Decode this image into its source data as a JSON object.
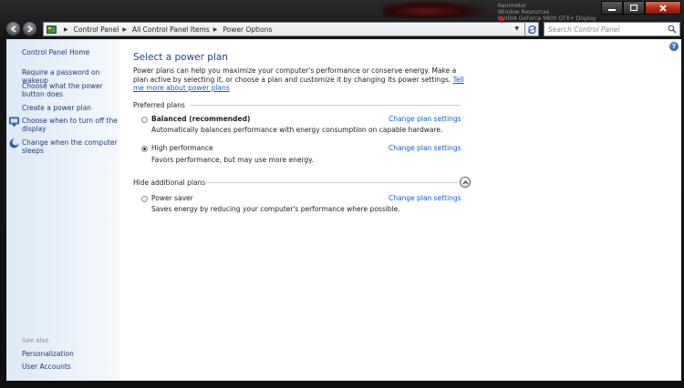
{
  "window": {
    "background_text": [
      "",
      "Rainmeter",
      "Window Resources",
      "",
      "NVIDIA GeForce 9800 GTX+ Display"
    ]
  },
  "address_bar": {
    "breadcrumbs": [
      "Control Panel",
      "All Control Panel Items",
      "Power Options"
    ],
    "search_placeholder": "Search Control Panel"
  },
  "sidebar": {
    "home_label": "Control Panel Home",
    "links": [
      {
        "label": "Require a password on wakeup"
      },
      {
        "label": "Choose what the power button does"
      },
      {
        "label": "Create a power plan"
      },
      {
        "label": "Choose when to turn off the display"
      },
      {
        "label": "Change when the computer sleeps"
      }
    ],
    "see_also_label": "See also",
    "see_also_links": [
      {
        "label": "Personalization"
      },
      {
        "label": "User Accounts"
      }
    ]
  },
  "main": {
    "title": "Select a power plan",
    "intro": "Power plans can help you maximize your computer's performance or conserve energy. Make a plan active by selecting it, or choose a plan and customize it by changing its power settings.",
    "intro_link": "Tell me more about power plans",
    "preferred_header": "Preferred plans",
    "hide_header": "Hide additional plans",
    "plans": [
      {
        "name": "Balanced (recommended)",
        "description": "Automatically balances performance with energy consumption on capable hardware.",
        "link": "Change plan settings",
        "selected": false
      },
      {
        "name": "High performance",
        "description": "Favors performance, but may use more energy.",
        "link": "Change plan settings",
        "selected": true
      },
      {
        "name": "Power saver",
        "description": "Saves energy by reducing your computer's performance where possible.",
        "link": "Change plan settings",
        "selected": false
      }
    ]
  },
  "colors": {
    "link": "#0b5ed7",
    "title": "#1e3f8a",
    "sidebar_link": "#1a3c78",
    "close_button": "#c0301a"
  }
}
